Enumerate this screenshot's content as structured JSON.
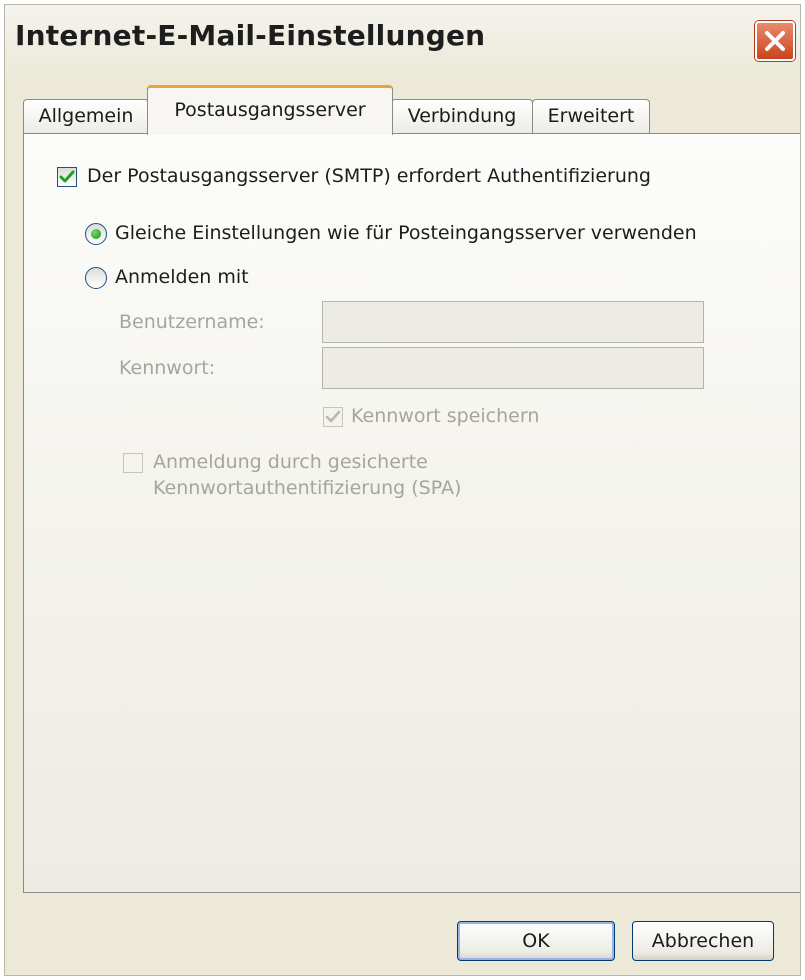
{
  "window": {
    "title": "Internet-E-Mail-Einstellungen"
  },
  "tabs": [
    {
      "label": "Allgemein",
      "active": false
    },
    {
      "label": "Postausgangsserver",
      "active": true
    },
    {
      "label": "Verbindung",
      "active": false
    },
    {
      "label": "Erweitert",
      "active": false
    }
  ],
  "auth": {
    "require_auth_label": "Der Postausgangsserver (SMTP) erfordert Authentifizierung",
    "require_auth_checked": true,
    "same_settings_label": "Gleiche Einstellungen wie für Posteingangsserver verwenden",
    "same_settings_selected": true,
    "login_with_label": "Anmelden mit",
    "login_with_selected": false,
    "username_label": "Benutzername:",
    "username_value": "",
    "password_label": "Kennwort:",
    "password_value": "",
    "save_password_label": "Kennwort speichern",
    "save_password_checked": true,
    "spa_label_line1": "Anmeldung durch gesicherte",
    "spa_label_line2": "Kennwortauthentifizierung (SPA)",
    "spa_checked": false
  },
  "buttons": {
    "ok": "OK",
    "cancel": "Abbrechen"
  },
  "colors": {
    "dialog_bg": "#ece9d8",
    "close_button": "#c9441c",
    "active_tab_highlight": "#e8a33a",
    "check_mark": "#21a121",
    "disabled_text": "#a6a59c"
  }
}
